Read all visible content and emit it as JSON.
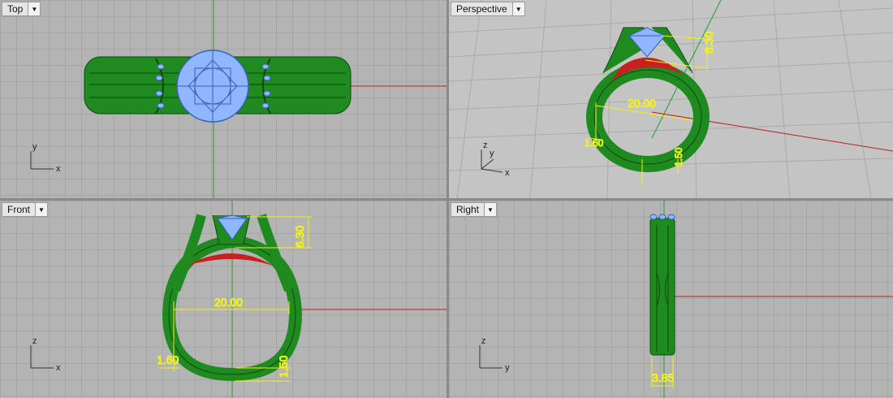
{
  "viewports": {
    "top": {
      "name": "Top",
      "axes": [
        "y",
        "x"
      ]
    },
    "perspective": {
      "name": "Perspective",
      "axes": [
        "z",
        "y",
        "x"
      ]
    },
    "front": {
      "name": "Front",
      "axes": [
        "z",
        "x"
      ]
    },
    "right": {
      "name": "Right",
      "axes": [
        "z",
        "y"
      ]
    }
  },
  "dimensions": {
    "height": "6.30",
    "inner_diameter": "20.00",
    "shank_side": "1.60",
    "shank_bottom": "1.50",
    "band_width": "3.85"
  },
  "colors": {
    "ring_green": "#1f8a1f",
    "gem_blue": "#8fb6ff",
    "dimension_yellow": "#f2f21a",
    "x_axis_red": "#b82020",
    "y_axis_green": "#22a022"
  },
  "icons": {
    "dropdown": "chevron-down-icon"
  }
}
